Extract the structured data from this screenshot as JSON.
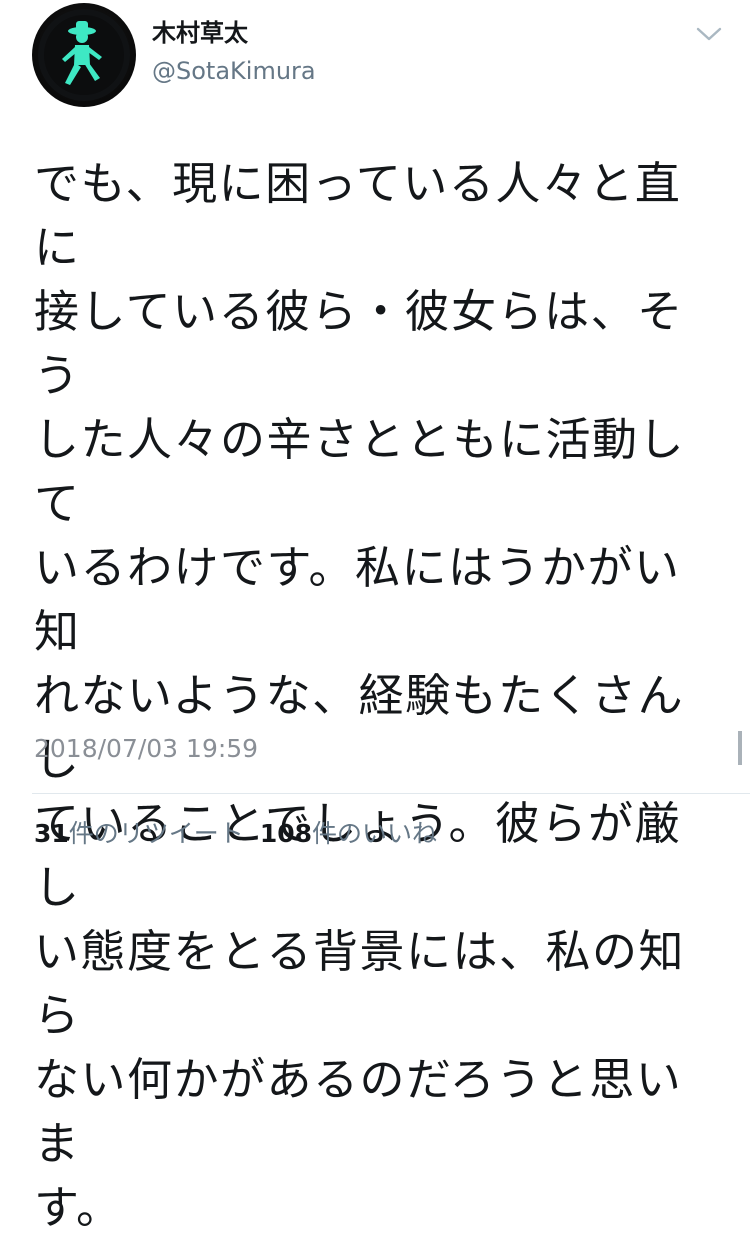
{
  "user": {
    "display_name": "木村草太",
    "handle": "@SotaKimura",
    "avatar_icon": "pedestrian-signal-icon"
  },
  "tweet": {
    "text": "でも、現に困っている人々と直に\n接している彼ら・彼女らは、そう\nした人々の辛さとともに活動して\nいるわけです。私にはうかがい知\nれないような、経験もたくさんし\nていることでしょう。彼らが厳し\nい態度をとる背景には、私の知ら\nない何かがあるのだろうと思いま\nす。",
    "timestamp": "2018/07/03 19:59"
  },
  "stats": {
    "retweets_count": "31",
    "retweets_label": "件のリツイート",
    "likes_count": "108",
    "likes_label": "件のいいね"
  },
  "colors": {
    "text": "#14171a",
    "secondary": "#657786",
    "signal_green": "#3ee8c4"
  }
}
